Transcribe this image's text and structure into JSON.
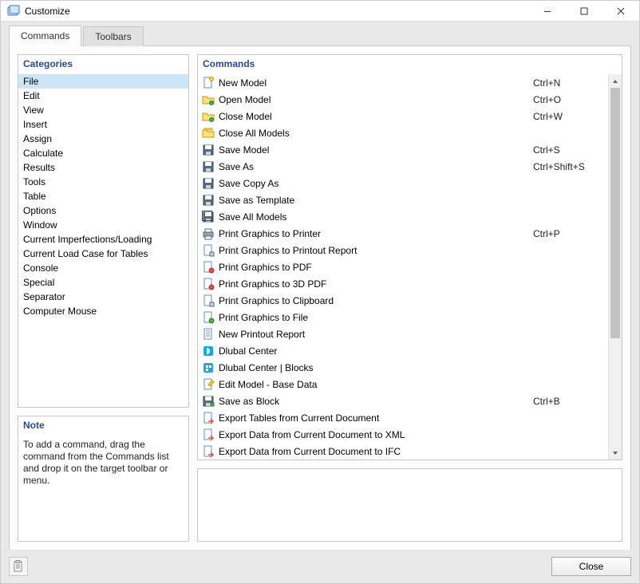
{
  "window": {
    "title": "Customize"
  },
  "tabs": {
    "commands": "Commands",
    "toolbars": "Toolbars",
    "active": "commands"
  },
  "categories_header": "Categories",
  "categories": [
    "File",
    "Edit",
    "View",
    "Insert",
    "Assign",
    "Calculate",
    "Results",
    "Tools",
    "Table",
    "Options",
    "Window",
    "Current Imperfections/Loading",
    "Current Load Case for Tables",
    "Console",
    "Special",
    "Separator",
    "Computer Mouse"
  ],
  "selected_category_index": 0,
  "note_header": "Note",
  "note_text": "To add a command, drag the command from the Commands list and drop it on the target toolbar or menu.",
  "commands_header": "Commands",
  "commands": [
    {
      "icon": "file-new",
      "label": "New Model",
      "shortcut": "Ctrl+N"
    },
    {
      "icon": "folder-open",
      "label": "Open Model",
      "shortcut": "Ctrl+O"
    },
    {
      "icon": "folder-open",
      "label": "Close Model",
      "shortcut": "Ctrl+W"
    },
    {
      "icon": "folder-multi",
      "label": "Close All Models",
      "shortcut": ""
    },
    {
      "icon": "save",
      "label": "Save Model",
      "shortcut": "Ctrl+S"
    },
    {
      "icon": "save",
      "label": "Save As",
      "shortcut": "Ctrl+Shift+S"
    },
    {
      "icon": "save-copy",
      "label": "Save Copy As",
      "shortcut": ""
    },
    {
      "icon": "save-template",
      "label": "Save as Template",
      "shortcut": ""
    },
    {
      "icon": "save-all",
      "label": "Save All Models",
      "shortcut": ""
    },
    {
      "icon": "printer",
      "label": "Print Graphics to Printer",
      "shortcut": "Ctrl+P"
    },
    {
      "icon": "print-report",
      "label": "Print Graphics to Printout Report",
      "shortcut": ""
    },
    {
      "icon": "print-pdf",
      "label": "Print Graphics to PDF",
      "shortcut": ""
    },
    {
      "icon": "print-3dpdf",
      "label": "Print Graphics to 3D PDF",
      "shortcut": ""
    },
    {
      "icon": "print-clip",
      "label": "Print Graphics to Clipboard",
      "shortcut": ""
    },
    {
      "icon": "print-file",
      "label": "Print Graphics to File",
      "shortcut": ""
    },
    {
      "icon": "report-new",
      "label": "New Printout Report",
      "shortcut": ""
    },
    {
      "icon": "dlubal",
      "label": "Dlubal Center",
      "shortcut": ""
    },
    {
      "icon": "dlubal-blocks",
      "label": "Dlubal Center | Blocks",
      "shortcut": ""
    },
    {
      "icon": "edit-doc",
      "label": "Edit Model - Base Data",
      "shortcut": ""
    },
    {
      "icon": "save-block",
      "label": "Save as Block",
      "shortcut": "Ctrl+B"
    },
    {
      "icon": "export-table",
      "label": "Export Tables from Current Document",
      "shortcut": ""
    },
    {
      "icon": "export-xml",
      "label": "Export Data from Current Document to XML",
      "shortcut": ""
    },
    {
      "icon": "export-ifc",
      "label": "Export Data from Current Document to IFC",
      "shortcut": ""
    }
  ],
  "close_button_label": "Close"
}
